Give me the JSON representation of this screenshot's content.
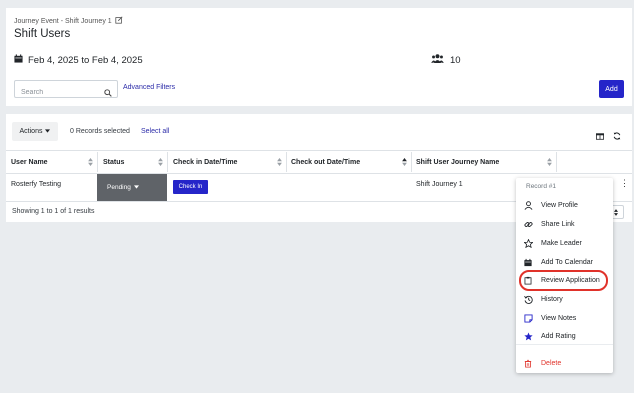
{
  "header": {
    "breadcrumb": "Journey Event - Shift Journey 1",
    "title": "Shift Users",
    "date_range": "Feb 4, 2025 to Feb 4, 2025",
    "user_count": "10"
  },
  "search": {
    "placeholder": "Search"
  },
  "filters": {
    "advanced_label": "Advanced Filters"
  },
  "add_button": "Add",
  "toolbar": {
    "actions_label": "Actions",
    "selected_info": "0 Records selected",
    "select_all_label": "Select all"
  },
  "table": {
    "columns": [
      "User Name",
      "Status",
      "Check in Date/Time",
      "Check out Date/Time",
      "Shift User Journey Name"
    ],
    "rows": [
      {
        "user_name": "Rosterfy Testing",
        "status": "Pending",
        "check_in_label": "Check In",
        "check_out": "",
        "journey_name": "Shift Journey 1"
      }
    ],
    "footer": "Showing 1 to 1 of 1 results"
  },
  "menu": {
    "header": "Record #1",
    "items": [
      {
        "label": "View Profile",
        "icon": "user-icon"
      },
      {
        "label": "Share Link",
        "icon": "link-icon"
      },
      {
        "label": "Make Leader",
        "icon": "star-outline-icon"
      },
      {
        "label": "Add To Calendar",
        "icon": "calendar-icon"
      },
      {
        "label": "Review Application",
        "icon": "clipboard-icon"
      },
      {
        "label": "History",
        "icon": "history-icon"
      },
      {
        "label": "View Notes",
        "icon": "note-icon"
      },
      {
        "label": "Add Rating",
        "icon": "star-filled-icon"
      }
    ],
    "delete_label": "Delete"
  },
  "colors": {
    "primary": "#2525c9",
    "status_bg": "#5f6368",
    "delete": "#e0322a",
    "highlight": "#e0322a"
  }
}
